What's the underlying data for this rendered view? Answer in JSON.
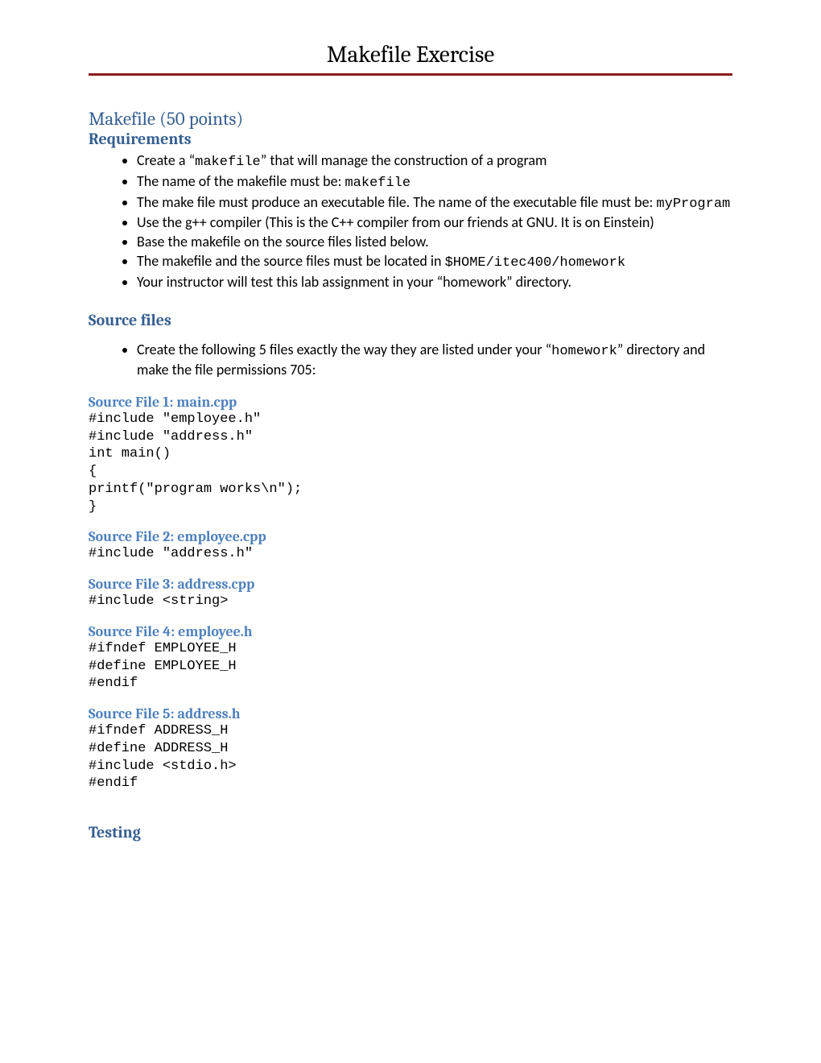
{
  "docTitle": "Makefile Exercise",
  "heading1": "Makefile (50 points)",
  "requirements": {
    "heading": "Requirements",
    "items": [
      {
        "pre": "Create a “",
        "code": "makefile",
        "post": "” that will manage the construction of a program"
      },
      {
        "pre": "The name of the makefile must be: ",
        "code": "makefile",
        "post": ""
      },
      {
        "pre": "The make file must produce an executable file. The name of the executable file must be: ",
        "code": "myProgram",
        "post": ""
      },
      {
        "pre": "Use the g++ compiler (This is the C++ compiler from our friends at GNU. It is on Einstein)",
        "code": "",
        "post": ""
      },
      {
        "pre": "Base the makefile on the source files listed below.",
        "code": "",
        "post": ""
      },
      {
        "pre": "The makefile and the source files must be located in ",
        "code": "$HOME/itec400/homework",
        "post": ""
      },
      {
        "pre": "Your instructor will test this lab assignment in your “homework” directory.",
        "code": "",
        "post": ""
      }
    ]
  },
  "sourceFiles": {
    "heading": "Source files",
    "intro": {
      "pre": "Create the following 5 files exactly the way they are listed under your “",
      "code": "homework",
      "post": "” directory and make the file permissions 705:"
    }
  },
  "sf1": {
    "title": "Source File 1: main.cpp",
    "code": "#include \"employee.h\"\n#include \"address.h\"\nint main()\n{\nprintf(\"program works\\n\");\n}"
  },
  "sf2": {
    "title": "Source File 2: employee.cpp",
    "code": "#include \"address.h\""
  },
  "sf3": {
    "title": "Source File 3: address.cpp",
    "code": "#include <string>"
  },
  "sf4": {
    "title": "Source File 4: employee.h",
    "code": "#ifndef EMPLOYEE_H\n#define EMPLOYEE_H\n#endif"
  },
  "sf5": {
    "title": "Source File 5: address.h",
    "code": "#ifndef ADDRESS_H\n#define ADDRESS_H\n#include <stdio.h>\n#endif"
  },
  "testing": {
    "heading": "Testing"
  }
}
